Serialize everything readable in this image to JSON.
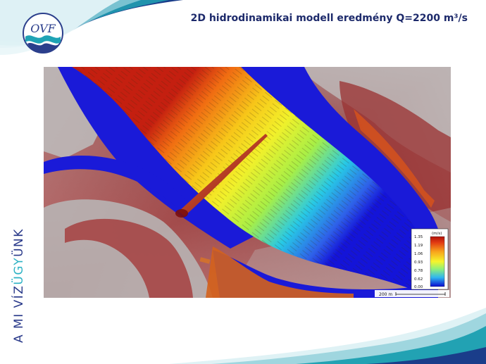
{
  "slide": {
    "title": "2D hidrodinamikai modell eredmény Q=2200 m³/s",
    "logo_text": "OVF",
    "side_text_prefix": "A MI VÍZ",
    "side_text_highlight": "ÜGY",
    "side_text_suffix": "ÜNK"
  },
  "map": {
    "legend": {
      "unit": "(m/s)",
      "values": [
        "1.35",
        "1.19",
        "1.06",
        "0.93",
        "0.78",
        "0.62",
        "0.00"
      ]
    },
    "scale_label": "200 m"
  },
  "colors": {
    "title": "#1d2a6b",
    "accent_teal": "#1fa3b5",
    "logo_blue": "#2b3f8c",
    "side_text": "#2a3a8a",
    "side_highlight": "#2db2c4"
  }
}
